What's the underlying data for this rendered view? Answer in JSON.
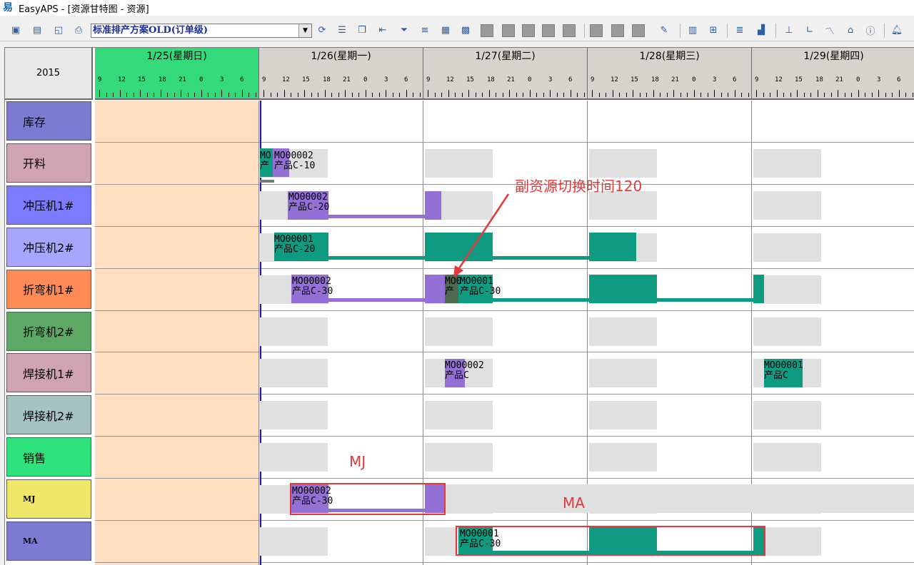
{
  "window": {
    "title": "EasyAPS - [资源甘特图 - 资源]",
    "icon": "easyaps-logo-icon"
  },
  "toolbar": {
    "scheme_value": "标准排产方案OLD(订单级)",
    "icons": [
      "save-icon",
      "print-icon",
      "preview-icon",
      "printer-setup-icon",
      "refresh-icon",
      "filter-icon",
      "copy-icon",
      "indent-icon",
      "funnel-icon",
      "align-icon",
      "page-icon",
      "chart-icon",
      "gray-block-icon",
      "gray-block-icon",
      "gray-block-icon",
      "gray-block-icon",
      "gray-block-icon",
      "gray-block-icon",
      "gray-block-icon",
      "gray-block-icon",
      "edit-icon",
      "report-icon",
      "grid-icon",
      "lines-icon",
      "bar-chart-icon",
      "axis-icon",
      "line-chart-icon",
      "home-icon",
      "info-icon",
      "bell-icon"
    ]
  },
  "gantt": {
    "year": "2015",
    "days": [
      "1/25(星期日)",
      "1/26(星期一)",
      "1/27(星期二)",
      "1/28(星期三)",
      "1/29(星期四)"
    ],
    "hour_ticks": [
      "9",
      "12",
      "15",
      "18",
      "21",
      "0",
      "3",
      "6"
    ],
    "resources": [
      "库存",
      "开料",
      "冲压机1#",
      "冲压机2#",
      "折弯机1#",
      "折弯机2#",
      "焊接机1#",
      "焊接机2#",
      "销售",
      "MJ",
      "MA"
    ],
    "resource_colors": [
      "#7b7bd4",
      "#cfa3b1",
      "#7b7bff",
      "#a6a6ff",
      "#ff8b57",
      "#5da865",
      "#cfa3b1",
      "#a6c3c3",
      "#2ee37b",
      "#efe66a",
      "#7b7bd4"
    ],
    "task_colors": {
      "MO00001": "#0f9a82",
      "MO00002": "#9470d6"
    },
    "tasks": {
      "kl_a": "MO\n产",
      "kl_b": "MO00002\n产品C-10",
      "cy1": "MO00002\n产品C-20",
      "cy2": "MO00001\n产品C-20",
      "zw1_a": "MO00002\n产品C-30",
      "zw1_b": "MO0\n产",
      "zw1_c": "MO0001\n产品C-30",
      "hj1_a": "MO00002\n产品C",
      "hj1_b": "MO00001\n产品C",
      "mj": "MO00002\n产品C-30",
      "ma": "MO00001\n产品C-30"
    }
  },
  "annotations": {
    "switch_note": "副资源切换时间120",
    "mj_label": "MJ",
    "ma_label": "MA"
  }
}
